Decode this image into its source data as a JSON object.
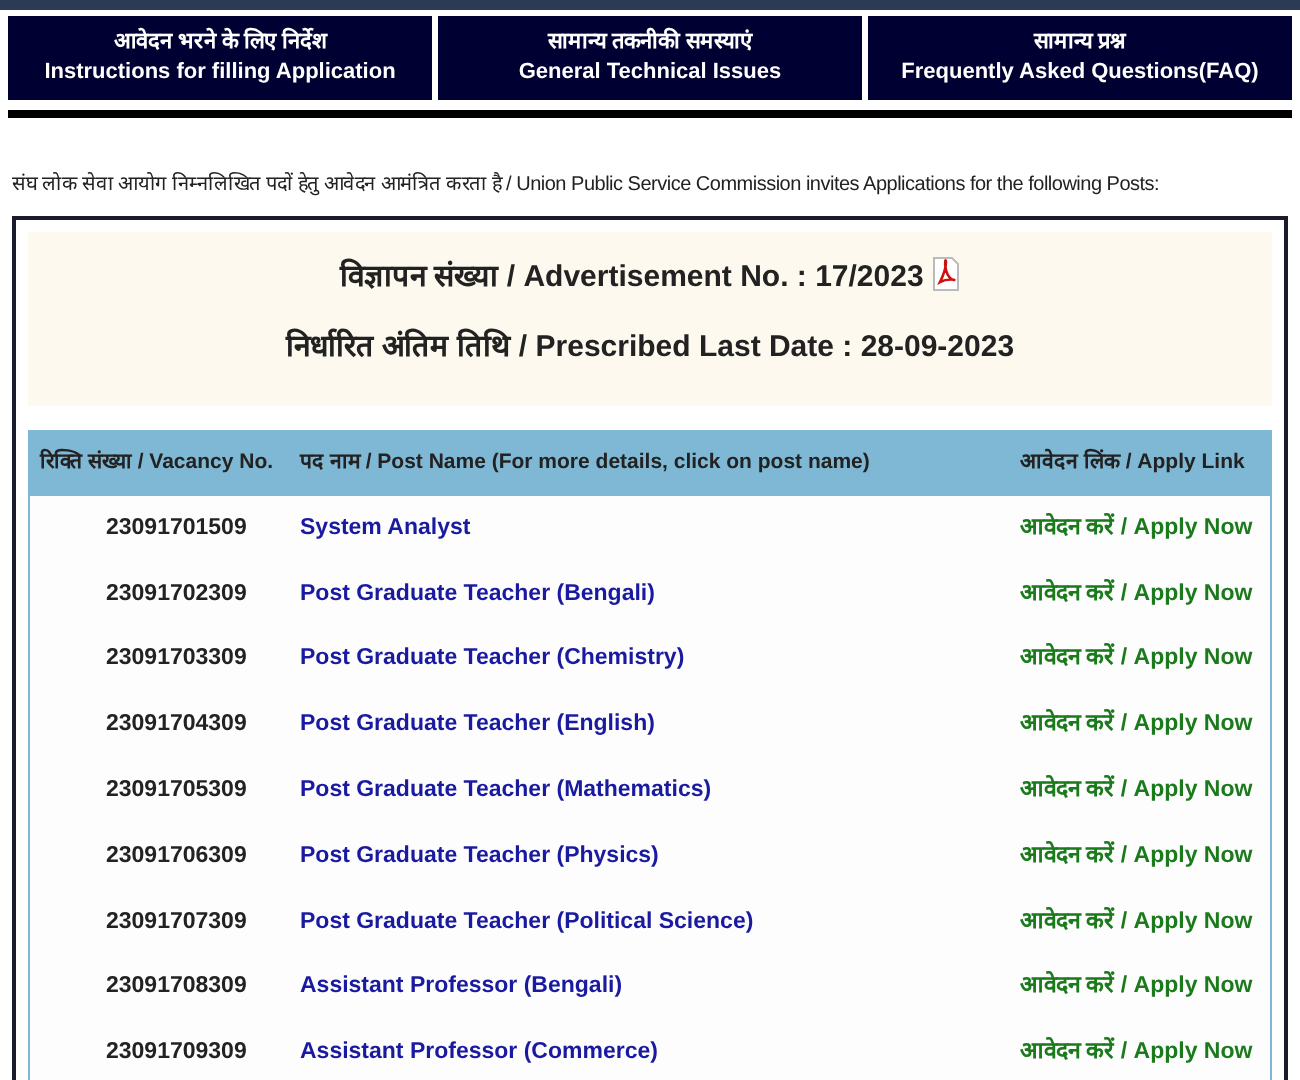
{
  "nav_tabs": [
    {
      "hindi": "आवेदन भरने के लिए निर्देश",
      "english": "Instructions for filling Application"
    },
    {
      "hindi": "सामान्य तकनीकी समस्याएं",
      "english": "General Technical Issues"
    },
    {
      "hindi": "सामान्य प्रश्न",
      "english": "Frequently Asked Questions(FAQ)"
    }
  ],
  "intro": "संघ लोक सेवा आयोग निम्नलिखित पदों हेतु आवेदन आमंत्रित करता है / Union Public Service Commission invites Applications for the following Posts:",
  "advertisement": "विज्ञापन संख्या / Advertisement No. : 17/2023",
  "last_date": "निर्धारित अंतिम तिथि / Prescribed Last Date : 28-09-2023",
  "table": {
    "columns": [
      "रिक्ति संख्या / Vacancy No.",
      "पद नाम / Post Name (For more details, click on post name)",
      "आवेदन लिंक / Apply Link"
    ],
    "rows": [
      {
        "vacancy": "23091701509",
        "post": "System Analyst",
        "link": "आवेदन करें / Apply Now"
      },
      {
        "vacancy": "23091702309",
        "post": "Post Graduate Teacher (Bengali)",
        "link": "आवेदन करें / Apply Now"
      },
      {
        "vacancy": "23091703309",
        "post": "Post Graduate Teacher (Chemistry)",
        "link": "आवेदन करें / Apply Now"
      },
      {
        "vacancy": "23091704309",
        "post": "Post Graduate Teacher (English)",
        "link": "आवेदन करें / Apply Now"
      },
      {
        "vacancy": "23091705309",
        "post": "Post Graduate Teacher (Mathematics)",
        "link": "आवेदन करें / Apply Now"
      },
      {
        "vacancy": "23091706309",
        "post": "Post Graduate Teacher (Physics)",
        "link": "आवेदन करें / Apply Now"
      },
      {
        "vacancy": "23091707309",
        "post": "Post Graduate Teacher (Political Science)",
        "link": "आवेदन करें / Apply Now"
      },
      {
        "vacancy": "23091708309",
        "post": "Assistant Professor (Bengali)",
        "link": "आवेदन करें / Apply Now"
      },
      {
        "vacancy": "23091709309",
        "post": "Assistant Professor (Commerce)",
        "link": "आवेदन करें / Apply Now"
      }
    ]
  }
}
